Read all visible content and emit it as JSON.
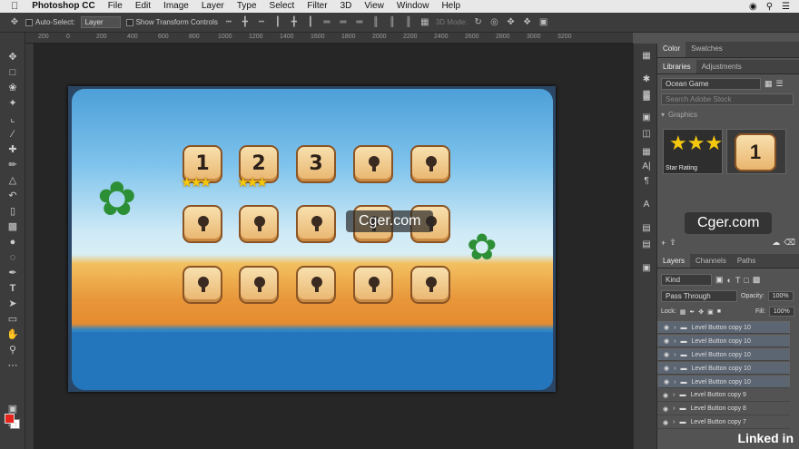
{
  "menu": {
    "app": "Photoshop CC",
    "items": [
      "File",
      "Edit",
      "Image",
      "Layer",
      "Type",
      "Select",
      "Filter",
      "3D",
      "View",
      "Window",
      "Help"
    ]
  },
  "options": {
    "auto_select": "Auto-Select:",
    "auto_select_value": "Layer",
    "show_transform": "Show Transform Controls",
    "mode_3d": "3D Mode:"
  },
  "ruler": [
    "200",
    "0",
    "200",
    "400",
    "600",
    "800",
    "1000",
    "1200",
    "1400",
    "1600",
    "1800",
    "2000",
    "2200",
    "2400",
    "2600",
    "2800",
    "3000",
    "3200"
  ],
  "artwork": {
    "buttons": [
      "1",
      "2",
      "3"
    ]
  },
  "watermark": "Cger.com",
  "panels": {
    "top_tabs": [
      "Color",
      "Swatches"
    ],
    "lib_tabs": [
      "Libraries",
      "Adjustments"
    ],
    "library_name": "Ocean Game",
    "search_placeholder": "Search Adobe Stock",
    "graphics_header": "Graphics",
    "graphic_1_label": "Star Rating",
    "graphic_2_text": "1",
    "layer_tabs": [
      "Layers",
      "Channels",
      "Paths"
    ],
    "kind": "Kind",
    "blend": "Pass Through",
    "opacity_label": "Opacity:",
    "opacity": "100%",
    "lock_label": "Lock:",
    "fill_label": "Fill:",
    "fill": "100%",
    "layers": [
      "Level Button copy 10",
      "Level Button copy 10",
      "Level Button copy 10",
      "Level Button copy 10",
      "Level Button copy 10",
      "Level Button copy 9",
      "Level Button copy 8",
      "Level Button copy 7"
    ]
  },
  "brand": "Linked in"
}
